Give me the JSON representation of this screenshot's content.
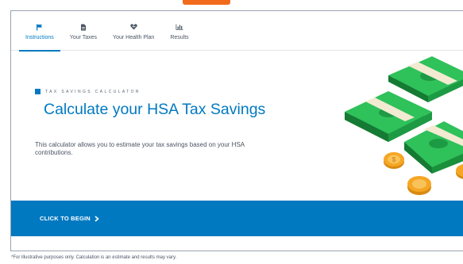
{
  "tabs": [
    {
      "label": "Instructions",
      "icon": "flag-icon",
      "active": true
    },
    {
      "label": "Your Taxes",
      "icon": "document-icon",
      "active": false
    },
    {
      "label": "Your Health Plan",
      "icon": "heart-icon",
      "active": false
    },
    {
      "label": "Results",
      "icon": "bar-chart-icon",
      "active": false
    }
  ],
  "hero": {
    "kicker": "TAX SAVINGS CALCULATOR",
    "title": "Calculate your HSA Tax Savings",
    "description": "This calculator allows you to estimate your tax savings based on your HSA contributions."
  },
  "cta": {
    "label": "CLICK TO BEGIN",
    "icon": "chevron-right-icon"
  },
  "footnote": "*For illustrative purposes only. Calculation is an estimate and results may vary.",
  "colors": {
    "accent": "#0079c1",
    "top_accent": "#f26b1d",
    "money_green": "#22b24c",
    "coin_gold": "#f5a623"
  }
}
